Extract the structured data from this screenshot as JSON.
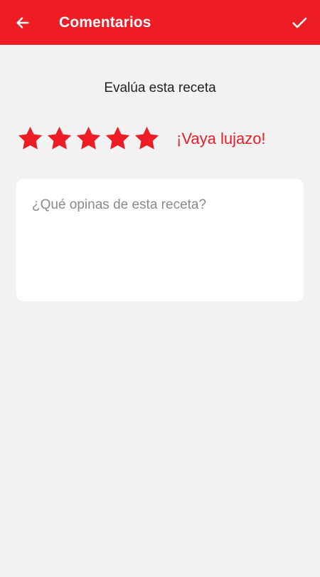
{
  "appbar": {
    "title": "Comentarios",
    "back_icon": "arrow-left-icon",
    "confirm_icon": "check-icon",
    "color": "#ee1c25"
  },
  "rating": {
    "prompt": "Evalúa esta receta",
    "stars_filled": 5,
    "stars_total": 5,
    "label": "¡Vaya lujazo!",
    "star_color": "#ee1c25"
  },
  "comment": {
    "value": "",
    "placeholder": "¿Qué opinas de esta receta?"
  }
}
